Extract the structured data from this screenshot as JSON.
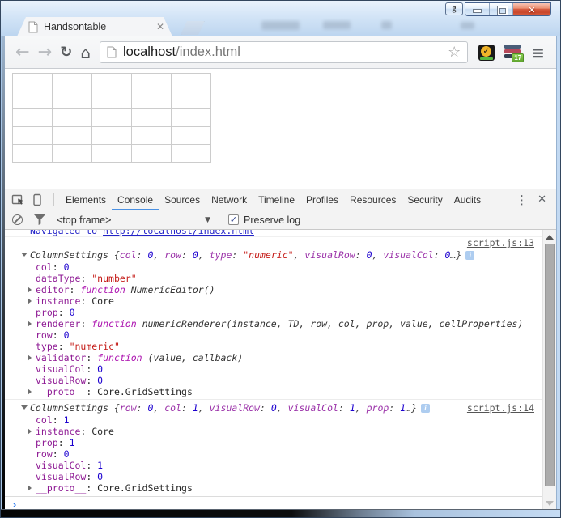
{
  "window": {
    "tab_title": "Handsontable"
  },
  "icons": {
    "back": "←",
    "forward": "→",
    "reload": "↻",
    "home": "⌂",
    "bookmark": "☆",
    "menu": "≡",
    "tab_close": "✕",
    "devtools_close": "✕",
    "overflow": "⋮",
    "caret": "▼",
    "check": "✓",
    "info": "i",
    "norton_check": "✓",
    "extension_badge": "17"
  },
  "toolbar": {
    "url_host": "localhost",
    "url_path": "/index.html"
  },
  "page": {
    "grid_rows": 5,
    "grid_cols": 5
  },
  "devtools": {
    "tabs": [
      "Elements",
      "Console",
      "Sources",
      "Network",
      "Timeline",
      "Profiles",
      "Resources",
      "Security",
      "Audits"
    ],
    "active_tab": "Console",
    "frame_selector": "<top frame>",
    "preserve_log": "Preserve log",
    "prompt": "›",
    "console_rows": [
      {
        "kind": "clipped",
        "seg": [
          [
            "info",
            "Navigated to "
          ],
          [
            "infolink",
            "http://localhost/index.html"
          ]
        ]
      },
      {
        "kind": "linkrow",
        "link": "script.js:13"
      },
      {
        "kind": "row",
        "obj": true,
        "arrow": "open",
        "indent": 0,
        "icon": true,
        "seg": [
          [
            "itname",
            "ColumnSettings "
          ],
          [
            "itplain",
            "{"
          ],
          [
            "itprop",
            "col"
          ],
          [
            "itplain",
            ": "
          ],
          [
            "itnum",
            "0"
          ],
          [
            "itplain",
            ", "
          ],
          [
            "itprop",
            "row"
          ],
          [
            "itplain",
            ": "
          ],
          [
            "itnum",
            "0"
          ],
          [
            "itplain",
            ", "
          ],
          [
            "itprop",
            "type"
          ],
          [
            "itplain",
            ": "
          ],
          [
            "itstr",
            "\"numeric\""
          ],
          [
            "itplain",
            ", "
          ],
          [
            "itprop",
            "visualRow"
          ],
          [
            "itplain",
            ": "
          ],
          [
            "itnum",
            "0"
          ],
          [
            "itplain",
            ", "
          ],
          [
            "itprop",
            "visualCol"
          ],
          [
            "itplain",
            ": "
          ],
          [
            "itnum",
            "0"
          ],
          [
            "itplain",
            "…}"
          ]
        ]
      },
      {
        "kind": "row",
        "indent": 1,
        "seg": [
          [
            "prop",
            "col"
          ],
          [
            "plain",
            ": "
          ],
          [
            "num",
            "0"
          ]
        ]
      },
      {
        "kind": "row",
        "indent": 1,
        "seg": [
          [
            "prop",
            "dataType"
          ],
          [
            "plain",
            ": "
          ],
          [
            "str",
            "\"number\""
          ]
        ]
      },
      {
        "kind": "row",
        "indent": 1,
        "arrow": "closed",
        "seg": [
          [
            "prop",
            "editor"
          ],
          [
            "plain",
            ": "
          ],
          [
            "kw",
            "function "
          ],
          [
            "sig",
            "NumericEditor()"
          ]
        ]
      },
      {
        "kind": "row",
        "indent": 1,
        "arrow": "closed",
        "seg": [
          [
            "prop",
            "instance"
          ],
          [
            "plain",
            ": "
          ],
          [
            "plain",
            "Core"
          ]
        ]
      },
      {
        "kind": "row",
        "indent": 1,
        "seg": [
          [
            "prop",
            "prop"
          ],
          [
            "plain",
            ": "
          ],
          [
            "num",
            "0"
          ]
        ]
      },
      {
        "kind": "row",
        "indent": 1,
        "arrow": "closed",
        "seg": [
          [
            "prop",
            "renderer"
          ],
          [
            "plain",
            ": "
          ],
          [
            "kw",
            "function "
          ],
          [
            "sig",
            "numericRenderer(instance, TD, row, col, prop, value, cellProperties)"
          ]
        ]
      },
      {
        "kind": "row",
        "indent": 1,
        "seg": [
          [
            "prop",
            "row"
          ],
          [
            "plain",
            ": "
          ],
          [
            "num",
            "0"
          ]
        ]
      },
      {
        "kind": "row",
        "indent": 1,
        "seg": [
          [
            "prop",
            "type"
          ],
          [
            "plain",
            ": "
          ],
          [
            "str",
            "\"numeric\""
          ]
        ]
      },
      {
        "kind": "row",
        "indent": 1,
        "arrow": "closed",
        "seg": [
          [
            "prop",
            "validator"
          ],
          [
            "plain",
            ": "
          ],
          [
            "kw",
            "function "
          ],
          [
            "sig",
            "(value, callback)"
          ]
        ]
      },
      {
        "kind": "row",
        "indent": 1,
        "seg": [
          [
            "prop",
            "visualCol"
          ],
          [
            "plain",
            ": "
          ],
          [
            "num",
            "0"
          ]
        ]
      },
      {
        "kind": "row",
        "indent": 1,
        "seg": [
          [
            "prop",
            "visualRow"
          ],
          [
            "plain",
            ": "
          ],
          [
            "num",
            "0"
          ]
        ]
      },
      {
        "kind": "row",
        "indent": 1,
        "arrow": "closed",
        "seg": [
          [
            "prop",
            "__proto__"
          ],
          [
            "plain",
            ": "
          ],
          [
            "plain",
            "Core.GridSettings"
          ]
        ]
      },
      {
        "kind": "row",
        "obj": true,
        "sep": true,
        "arrow": "open",
        "indent": 0,
        "icon": true,
        "link": "script.js:14",
        "seg": [
          [
            "itname",
            "ColumnSettings "
          ],
          [
            "itplain",
            "{"
          ],
          [
            "itprop",
            "row"
          ],
          [
            "itplain",
            ": "
          ],
          [
            "itnum",
            "0"
          ],
          [
            "itplain",
            ", "
          ],
          [
            "itprop",
            "col"
          ],
          [
            "itplain",
            ": "
          ],
          [
            "itnum",
            "1"
          ],
          [
            "itplain",
            ", "
          ],
          [
            "itprop",
            "visualRow"
          ],
          [
            "itplain",
            ": "
          ],
          [
            "itnum",
            "0"
          ],
          [
            "itplain",
            ", "
          ],
          [
            "itprop",
            "visualCol"
          ],
          [
            "itplain",
            ": "
          ],
          [
            "itnum",
            "1"
          ],
          [
            "itplain",
            ", "
          ],
          [
            "itprop",
            "prop"
          ],
          [
            "itplain",
            ": "
          ],
          [
            "itnum",
            "1"
          ],
          [
            "itplain",
            "…}"
          ]
        ]
      },
      {
        "kind": "row",
        "indent": 1,
        "seg": [
          [
            "prop",
            "col"
          ],
          [
            "plain",
            ": "
          ],
          [
            "num",
            "1"
          ]
        ]
      },
      {
        "kind": "row",
        "indent": 1,
        "arrow": "closed",
        "seg": [
          [
            "prop",
            "instance"
          ],
          [
            "plain",
            ": "
          ],
          [
            "plain",
            "Core"
          ]
        ]
      },
      {
        "kind": "row",
        "indent": 1,
        "seg": [
          [
            "prop",
            "prop"
          ],
          [
            "plain",
            ": "
          ],
          [
            "num",
            "1"
          ]
        ]
      },
      {
        "kind": "row",
        "indent": 1,
        "seg": [
          [
            "prop",
            "row"
          ],
          [
            "plain",
            ": "
          ],
          [
            "num",
            "0"
          ]
        ]
      },
      {
        "kind": "row",
        "indent": 1,
        "seg": [
          [
            "prop",
            "visualCol"
          ],
          [
            "plain",
            ": "
          ],
          [
            "num",
            "1"
          ]
        ]
      },
      {
        "kind": "row",
        "indent": 1,
        "seg": [
          [
            "prop",
            "visualRow"
          ],
          [
            "plain",
            ": "
          ],
          [
            "num",
            "0"
          ]
        ]
      },
      {
        "kind": "row",
        "indent": 1,
        "arrow": "closed",
        "seg": [
          [
            "prop",
            "__proto__"
          ],
          [
            "plain",
            ": "
          ],
          [
            "plain",
            "Core.GridSettings"
          ]
        ]
      },
      {
        "kind": "prompt"
      }
    ]
  }
}
